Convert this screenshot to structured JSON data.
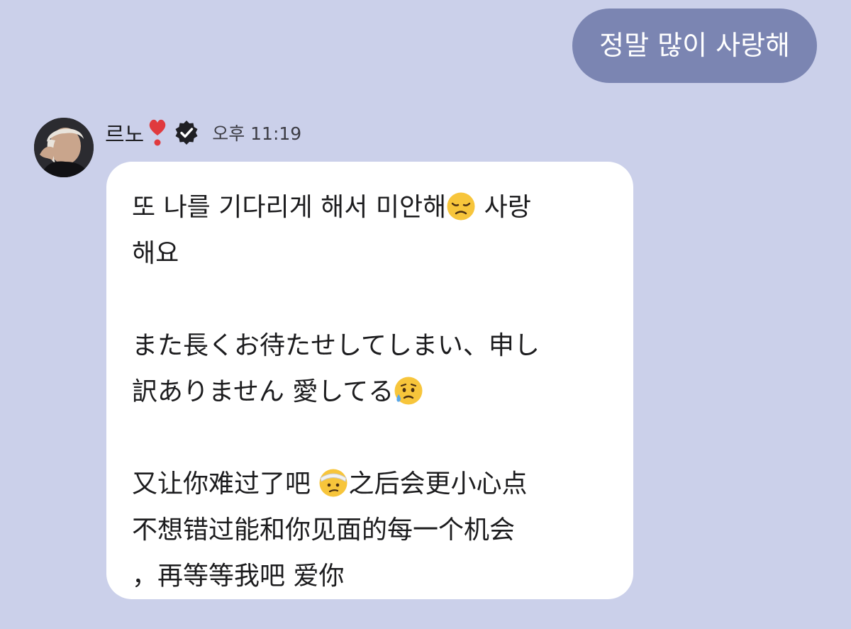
{
  "outgoing_message": {
    "text": "정말 많이 사랑해",
    "bubble_color": "#7b85b2"
  },
  "incoming_message": {
    "sender_name": "르노",
    "timestamp": "오후 11:19",
    "icons": [
      "heart-exclamation-icon",
      "verified-badge-icon",
      "disappointed-face-icon",
      "sad-sweat-face-icon",
      "bandaged-face-icon"
    ],
    "paragraphs": {
      "korean": {
        "line1": "또 나를 기다리게 해서 미안해",
        "line1_after": " 사랑",
        "line2": "해요"
      },
      "japanese": {
        "line1": "また長くお待たせしてしまい、申し",
        "line2": "訳ありません 愛してる"
      },
      "chinese": {
        "line1_before": "又让你难过了吧 ",
        "line1_after": "之后会更小心点",
        "line2": " 不想错过能和你见面的每一个机会",
        "line3": "，再等等我吧 爱你"
      }
    },
    "bubble_color": "#ffffff"
  },
  "colors": {
    "background": "#cbd0ea",
    "verified_badge": "#1f1f24",
    "heart": "#e03a3e"
  }
}
